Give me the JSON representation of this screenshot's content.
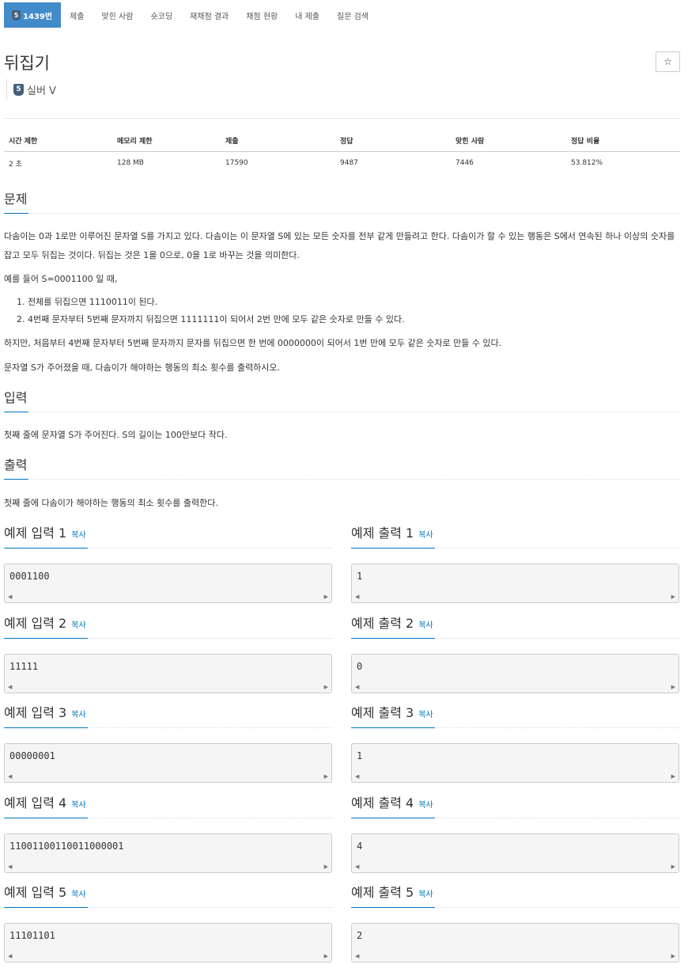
{
  "nav": {
    "problem_tier": "5",
    "problem_label": "1439번",
    "items": [
      "제출",
      "맞힌 사람",
      "숏코딩",
      "재채점 결과",
      "채점 현황",
      "내 제출",
      "질문 검색"
    ]
  },
  "problem": {
    "title": "뒤집기",
    "star": "☆",
    "tier_number": "5",
    "tier_name": "실버 V"
  },
  "info": {
    "headers": [
      "시간 제한",
      "메모리 제한",
      "제출",
      "정답",
      "맞힌 사람",
      "정답 비율"
    ],
    "values": [
      "2 초",
      "128 MB",
      "17590",
      "9487",
      "7446",
      "53.812%"
    ]
  },
  "sections": {
    "description": {
      "title": "문제",
      "p1": "다솜이는 0과 1로만 이루어진 문자열 S를 가지고 있다. 다솜이는 이 문자열 S에 있는 모든 숫자를 전부 같게 만들려고 한다. 다솜이가 할 수 있는 행동은 S에서 연속된 하나 이상의 숫자를 잡고 모두 뒤집는 것이다. 뒤집는 것은 1을 0으로, 0을 1로 바꾸는 것을 의미한다.",
      "p2": "예를 들어 S=0001100 일 때,",
      "list": [
        "1. 전체를 뒤집으면 1110011이 된다.",
        "2. 4번째 문자부터 5번째 문자까지 뒤집으면 1111111이 되어서 2번 만에 모두 같은 숫자로 만들 수 있다."
      ],
      "p3": "하지만, 처음부터 4번째 문자부터 5번째 문자까지 문자를 뒤집으면 한 번에 0000000이 되어서 1번 만에 모두 같은 숫자로 만들 수 있다.",
      "p4": "문자열 S가 주어졌을 때, 다솜이가 해야하는 행동의 최소 횟수를 출력하시오."
    },
    "input": {
      "title": "입력",
      "text": "첫째 줄에 문자열 S가 주어진다. S의 길이는 100만보다 작다."
    },
    "output": {
      "title": "출력",
      "text": "첫째 줄에 다솜이가 해야하는 행동의 최소 횟수를 출력한다."
    }
  },
  "copy_label": "복사",
  "samples": [
    {
      "in_title": "예제 입력 1",
      "in": "0001100",
      "out_title": "예제 출력 1",
      "out": "1"
    },
    {
      "in_title": "예제 입력 2",
      "in": "11111",
      "out_title": "예제 출력 2",
      "out": "0"
    },
    {
      "in_title": "예제 입력 3",
      "in": "00000001",
      "out_title": "예제 출력 3",
      "out": "1"
    },
    {
      "in_title": "예제 입력 4",
      "in": "11001100110011000001",
      "out_title": "예제 출력 4",
      "out": "4"
    },
    {
      "in_title": "예제 입력 5",
      "in": "11101101",
      "out_title": "예제 출력 5",
      "out": "2"
    }
  ]
}
